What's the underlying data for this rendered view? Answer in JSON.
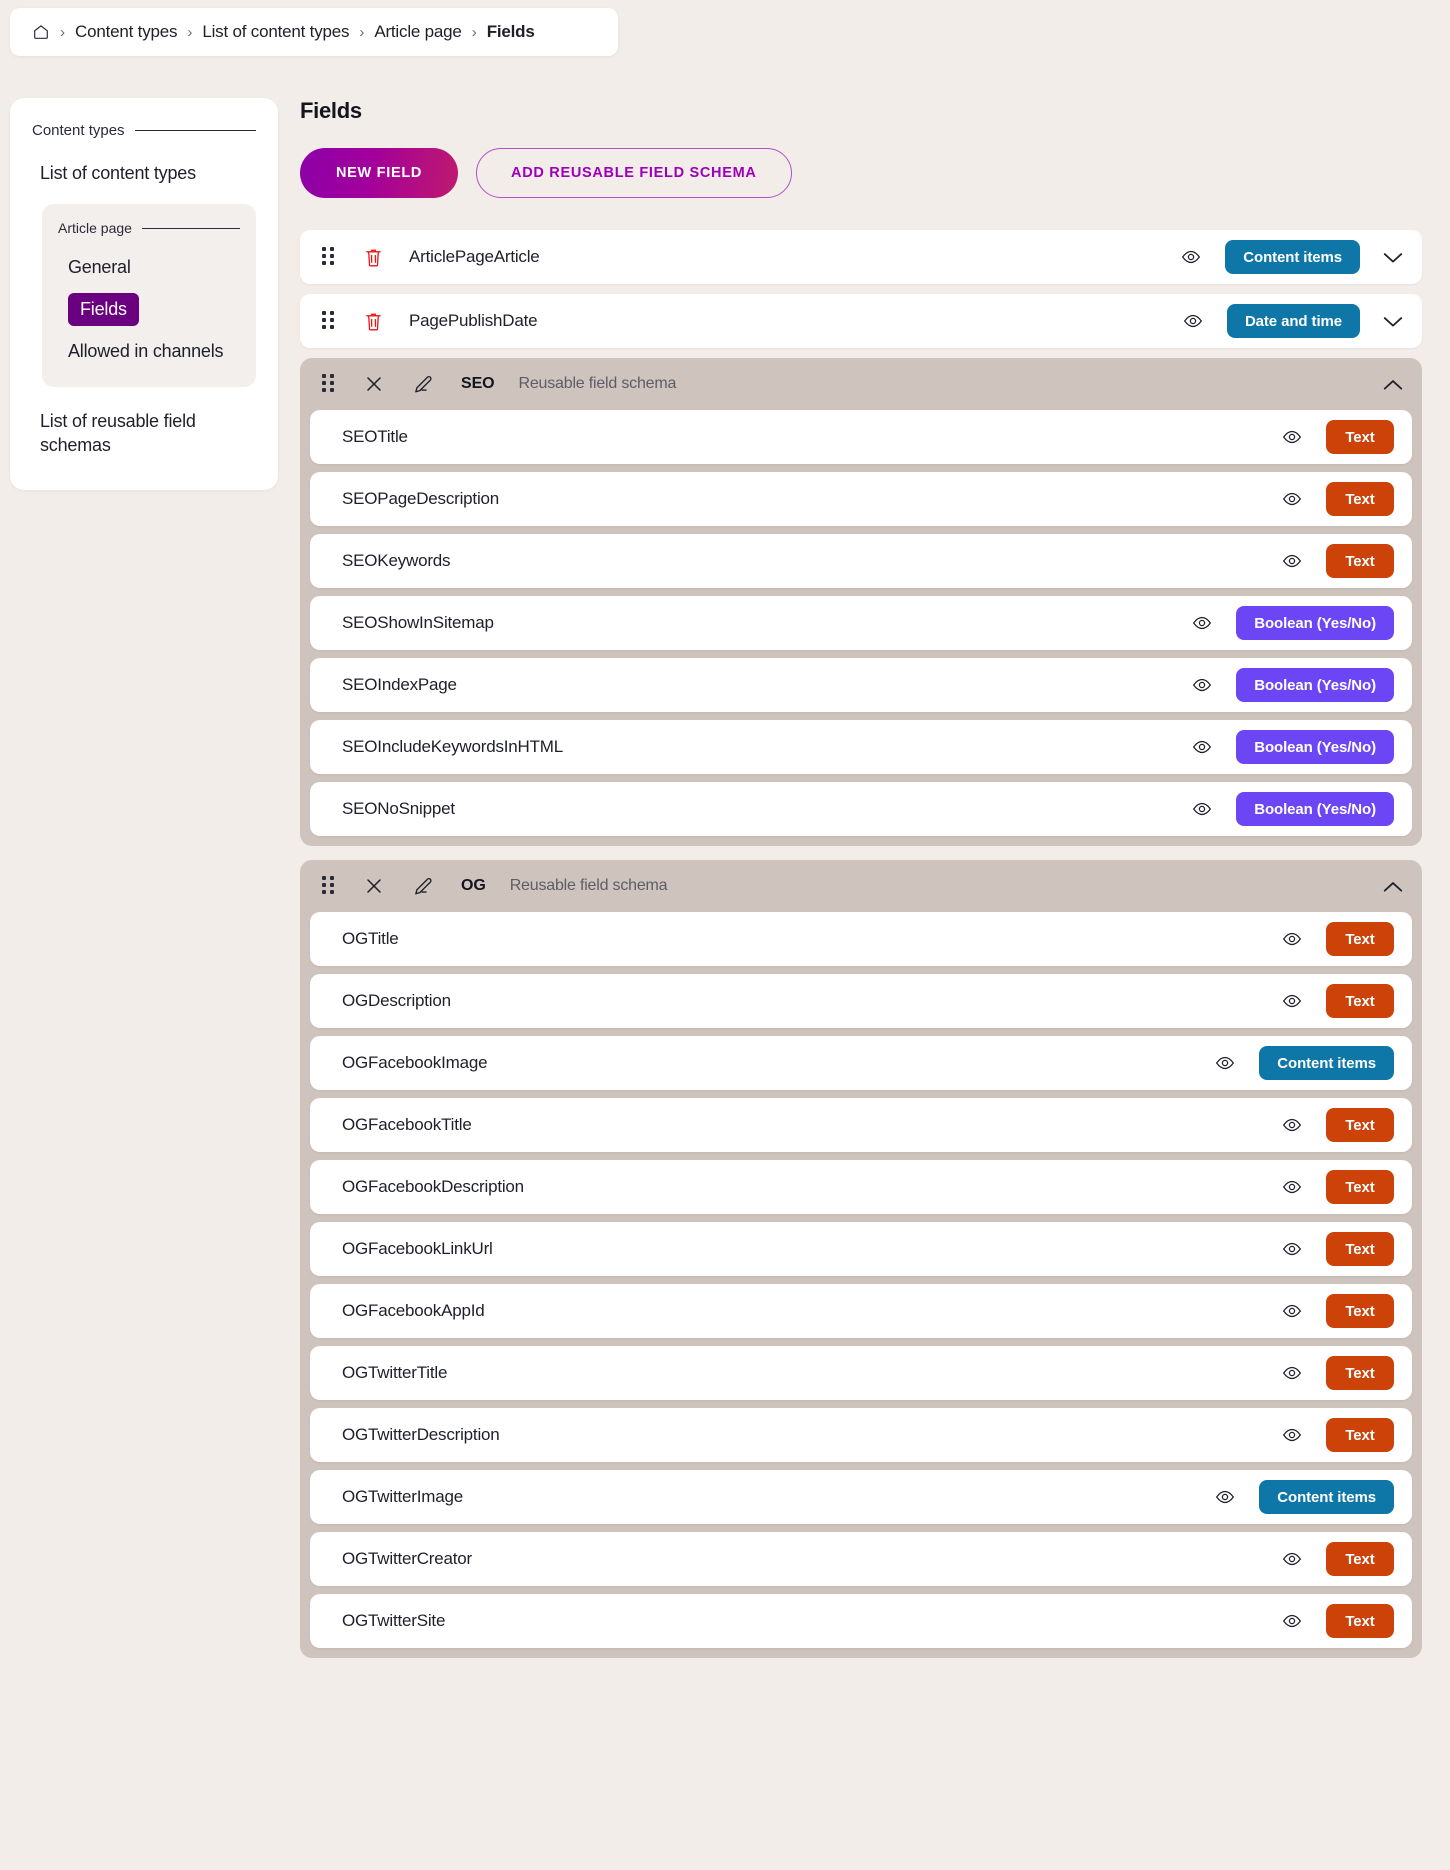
{
  "breadcrumb": {
    "home_icon": "home-icon",
    "separator": "›",
    "items": [
      {
        "label": "Content types"
      },
      {
        "label": "List of content types"
      },
      {
        "label": "Article page"
      },
      {
        "label": "Fields"
      }
    ]
  },
  "sidebar": {
    "group_label": "Content types",
    "link_list_of_content_types": "List of content types",
    "sub": {
      "group_label": "Article page",
      "items": [
        {
          "label": "General",
          "active": false
        },
        {
          "label": "Fields",
          "active": true
        },
        {
          "label": "Allowed in channels",
          "active": false
        }
      ]
    },
    "link_list_of_reusable_field_schemas": "List of reusable field schemas"
  },
  "main": {
    "title": "Fields",
    "new_field_label": "NEW FIELD",
    "add_reusable_label": "ADD REUSABLE FIELD SCHEMA",
    "top_fields": [
      {
        "name": "ArticlePageArticle",
        "badge": "Content items",
        "badge_kind": "content-items"
      },
      {
        "name": "PagePublishDate",
        "badge": "Date and time",
        "badge_kind": "datetime"
      }
    ],
    "schemas": [
      {
        "code": "SEO",
        "kind_label": "Reusable field schema",
        "fields": [
          {
            "name": "SEOTitle",
            "badge": "Text",
            "badge_kind": "text"
          },
          {
            "name": "SEOPageDescription",
            "badge": "Text",
            "badge_kind": "text"
          },
          {
            "name": "SEOKeywords",
            "badge": "Text",
            "badge_kind": "text"
          },
          {
            "name": "SEOShowInSitemap",
            "badge": "Boolean (Yes/No)",
            "badge_kind": "boolean"
          },
          {
            "name": "SEOIndexPage",
            "badge": "Boolean (Yes/No)",
            "badge_kind": "boolean"
          },
          {
            "name": "SEOIncludeKeywordsInHTML",
            "badge": "Boolean (Yes/No)",
            "badge_kind": "boolean"
          },
          {
            "name": "SEONoSnippet",
            "badge": "Boolean (Yes/No)",
            "badge_kind": "boolean"
          }
        ]
      },
      {
        "code": "OG",
        "kind_label": "Reusable field schema",
        "fields": [
          {
            "name": "OGTitle",
            "badge": "Text",
            "badge_kind": "text"
          },
          {
            "name": "OGDescription",
            "badge": "Text",
            "badge_kind": "text"
          },
          {
            "name": "OGFacebookImage",
            "badge": "Content items",
            "badge_kind": "content-items"
          },
          {
            "name": "OGFacebookTitle",
            "badge": "Text",
            "badge_kind": "text"
          },
          {
            "name": "OGFacebookDescription",
            "badge": "Text",
            "badge_kind": "text"
          },
          {
            "name": "OGFacebookLinkUrl",
            "badge": "Text",
            "badge_kind": "text"
          },
          {
            "name": "OGFacebookAppId",
            "badge": "Text",
            "badge_kind": "text"
          },
          {
            "name": "OGTwitterTitle",
            "badge": "Text",
            "badge_kind": "text"
          },
          {
            "name": "OGTwitterDescription",
            "badge": "Text",
            "badge_kind": "text"
          },
          {
            "name": "OGTwitterImage",
            "badge": "Content items",
            "badge_kind": "content-items"
          },
          {
            "name": "OGTwitterCreator",
            "badge": "Text",
            "badge_kind": "text"
          },
          {
            "name": "OGTwitterSite",
            "badge": "Text",
            "badge_kind": "text"
          }
        ]
      }
    ]
  },
  "colors": {
    "active_nav": "#6a0080",
    "badge_text": "#cc4208",
    "badge_content_items": "#0f77a8",
    "badge_boolean": "#6c46f5",
    "trash": "#e8191c",
    "schema_band": "#cec3bd",
    "page_bg": "#f2ede9"
  }
}
